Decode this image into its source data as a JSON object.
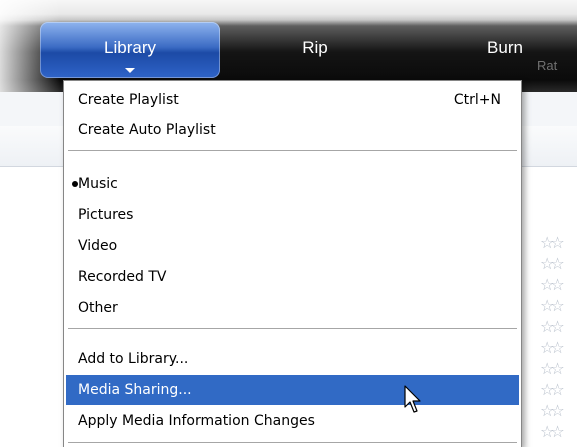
{
  "toolbar": {
    "tabs": [
      {
        "label": "Library",
        "active": true
      },
      {
        "label": "Rip"
      },
      {
        "label": "Burn"
      }
    ]
  },
  "background_list": {
    "column_header_partial": "Rat",
    "rating_icon": "star-outline-icon",
    "rating_rows_visible": 10
  },
  "menu": {
    "items": [
      {
        "label": "Create Playlist",
        "shortcut": "Ctrl+N"
      },
      {
        "label": "Create Auto Playlist"
      },
      {
        "label": "Music",
        "selected": true
      },
      {
        "label": "Pictures"
      },
      {
        "label": "Video"
      },
      {
        "label": "Recorded TV"
      },
      {
        "label": "Other"
      },
      {
        "label": "Add to Library..."
      },
      {
        "label": "Media Sharing...",
        "highlighted": true
      },
      {
        "label": "Apply Media Information Changes"
      }
    ]
  },
  "colors": {
    "highlight": "#316ac5",
    "active_tab": "#2f64c8",
    "toolbar_dark": "#141414"
  },
  "pointer": "mouse-pointer-icon"
}
